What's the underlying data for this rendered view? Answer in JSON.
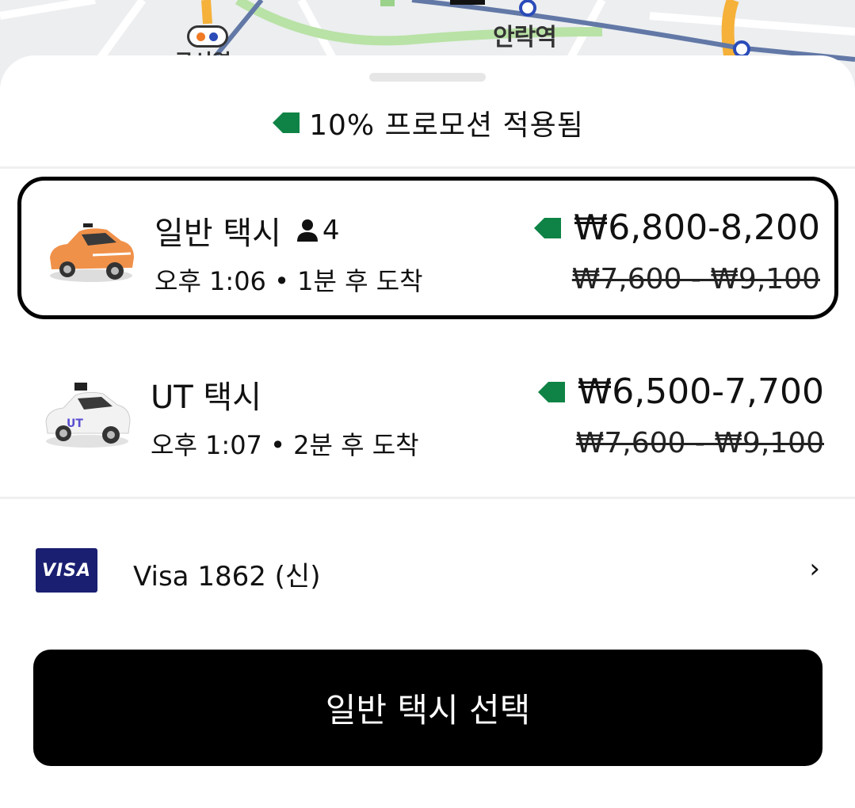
{
  "map": {
    "station_label": "안락역",
    "partial_label": "구서역"
  },
  "promo": {
    "text": "10% 프로모션 적용됨",
    "tag_icon": "price-tag-icon",
    "tag_color": "#0e8345"
  },
  "rides": [
    {
      "name": "일반 택시",
      "capacity": "4",
      "eta": "오후 1:06 • 1분 후 도착",
      "price": "₩6,800-8,200",
      "original_price": "₩7,600 - ₩9,100",
      "car_color": "#f0914a",
      "selected": true
    },
    {
      "name": "UT 택시",
      "eta": "오후 1:07 • 2분 후 도착",
      "price": "₩6,500-7,700",
      "original_price": "₩7,600 - ₩9,100",
      "car_color": "#f2f2f2",
      "selected": false
    }
  ],
  "payment": {
    "card_brand": "VISA",
    "label": "Visa 1862 (신)",
    "chevron": "›"
  },
  "select_button": {
    "label": "일반 택시 선택"
  },
  "colors": {
    "accent_green": "#0e8345",
    "button_bg": "#000000",
    "visa_blue": "#1a1f71"
  }
}
